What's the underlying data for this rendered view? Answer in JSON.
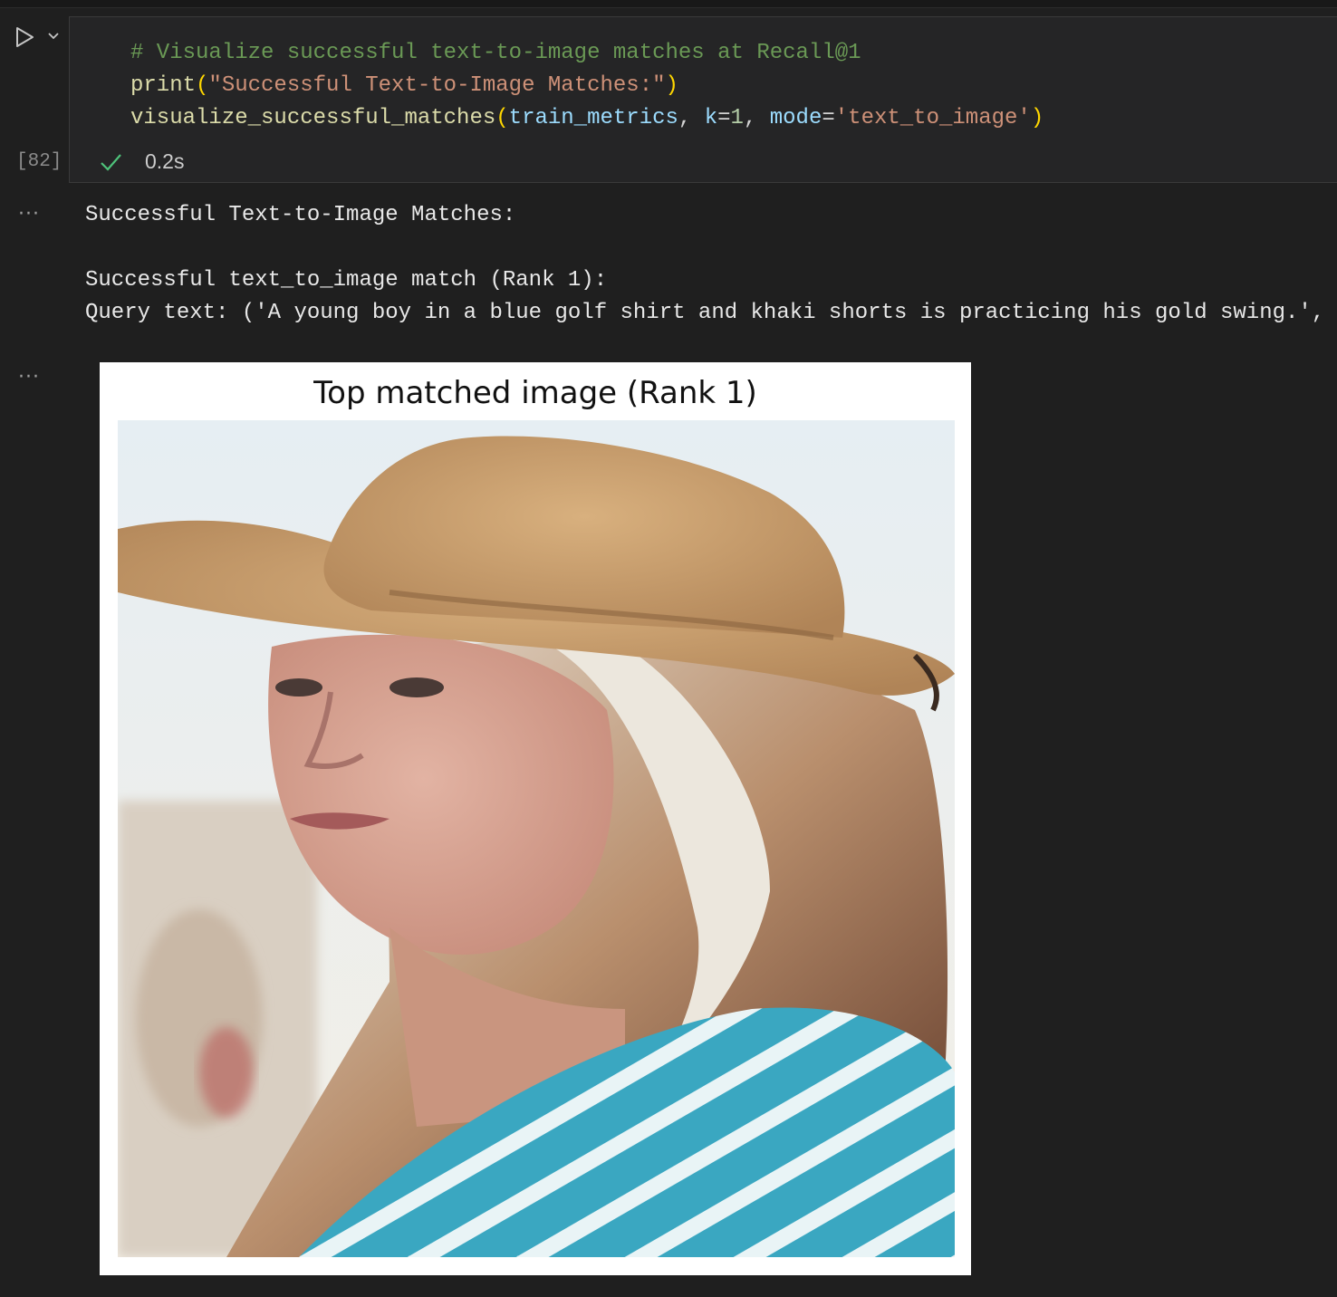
{
  "cell": {
    "execution_count": "[82]",
    "code": {
      "line1_comment": "# Visualize successful text-to-image matches at Recall@1",
      "line2_func": "print",
      "line2_string": "\"Successful Text-to-Image Matches:\"",
      "line3_func": "visualize_successful_matches",
      "line3_arg1": "train_metrics",
      "line3_param_k": "k",
      "line3_value_k": "1",
      "line3_param_mode": "mode",
      "line3_value_mode": "'text_to_image'"
    },
    "status": {
      "duration": "0.2s",
      "icon": "check-icon"
    }
  },
  "output": {
    "more_label": "···",
    "line1": "Successful Text-to-Image Matches:",
    "line2": "Successful text_to_image match (Rank 1):",
    "line3": "Query text: ('A young boy in a blue golf shirt and khaki shorts is practicing his gold swing.',",
    "figure_title": "Top matched image (Rank 1)"
  },
  "colors": {
    "background": "#1f1f1f",
    "cell_background": "#252526",
    "comment": "#6a9955",
    "function": "#dcdcaa",
    "string": "#ce9178",
    "variable": "#9cdcfe",
    "check": "#4ec27a"
  }
}
